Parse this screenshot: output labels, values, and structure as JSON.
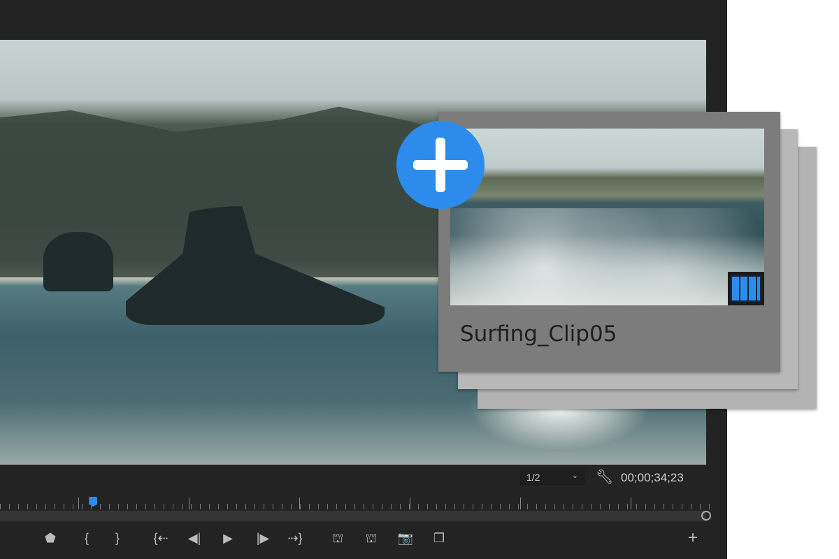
{
  "monitor": {
    "resolution": "1/2",
    "resolution_chevron": "⌄",
    "timecode": "00;00;34;23",
    "playhead_percent": 12
  },
  "clip_card": {
    "name": "Surfing_Clip05",
    "type_icon": "film-strip-icon",
    "accent": "#2d8ceb"
  },
  "controls": [
    {
      "name": "add-marker-button",
      "icon": "⬟"
    },
    {
      "name": "mark-in-button",
      "icon": "{"
    },
    {
      "name": "mark-out-button",
      "icon": "}"
    },
    {
      "name": "go-to-in-button",
      "icon": "{⇠"
    },
    {
      "name": "step-back-button",
      "icon": "◀|"
    },
    {
      "name": "play-button",
      "icon": "▶"
    },
    {
      "name": "step-forward-button",
      "icon": "|▶"
    },
    {
      "name": "go-to-out-button",
      "icon": "⇢}"
    },
    {
      "name": "insert-button",
      "icon": "⛫"
    },
    {
      "name": "overwrite-button",
      "icon": "⛫"
    },
    {
      "name": "export-frame-button",
      "icon": "📷"
    },
    {
      "name": "comparison-view-button",
      "icon": "❐"
    },
    {
      "name": "button-editor-button",
      "icon": "+"
    }
  ]
}
